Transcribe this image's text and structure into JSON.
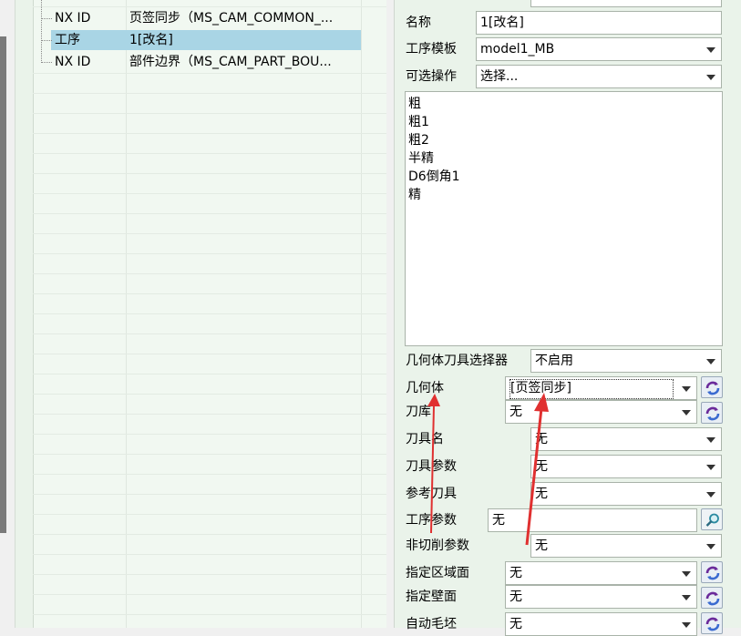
{
  "tree": {
    "rows": [
      {
        "type": "NX ID",
        "value": "页签同步（MS_CAM_COMMON_..."
      },
      {
        "type": "工序",
        "value": "1[改名]"
      },
      {
        "type": "NX ID",
        "value": "部件边界（MS_CAM_PART_BOU..."
      }
    ]
  },
  "form": {
    "name_label": "名称",
    "name_value": "1[改名]",
    "template_label": "工序模板",
    "template_value": "model1_MB",
    "optional_label": "可选操作",
    "optional_value": "选择...",
    "operations": [
      "粗",
      "粗1",
      "粗2",
      "半精",
      "D6倒角1",
      "精"
    ],
    "geo_tool_selector_label": "几何体刀具选择器",
    "geo_tool_selector_value": "不启用",
    "geometry_label": "几何体",
    "geometry_value": "[页签同步]",
    "tool_lib_label": "刀库",
    "tool_lib_value": "无",
    "tool_name_label": "刀具名",
    "tool_name_value": "无",
    "tool_param_label": "刀具参数",
    "tool_param_value": "无",
    "ref_tool_label": "参考刀具",
    "ref_tool_value": "无",
    "op_param_label": "工序参数",
    "op_param_value": "无",
    "noncut_label": "非切削参数",
    "noncut_value": "无",
    "cut_area_label": "指定区域面",
    "cut_area_value": "无",
    "wall_label": "指定壁面",
    "wall_value": "无",
    "blank_label": "自动毛坯",
    "blank_value": "无"
  },
  "colors": {
    "arrow": "#e03030",
    "selection": "#a9d5e5"
  }
}
